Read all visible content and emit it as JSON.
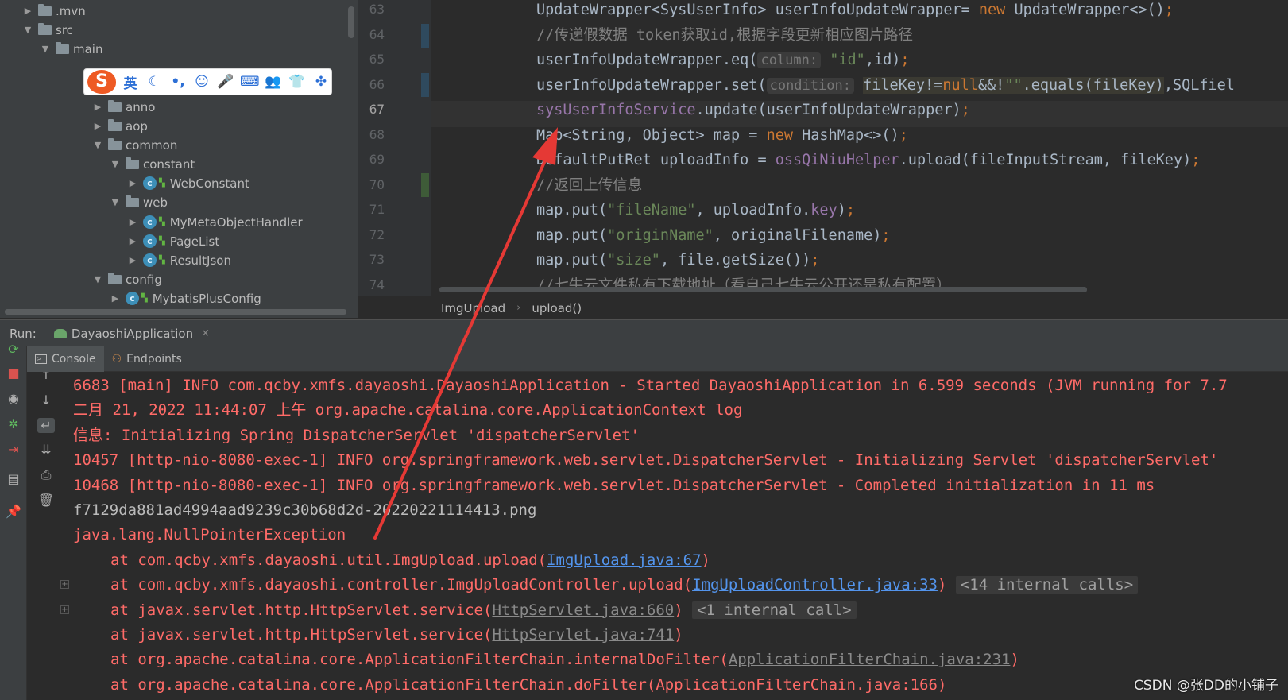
{
  "project_tree": [
    {
      "label": ".mvn",
      "kind": "folder",
      "indent": 0,
      "arrow": "right"
    },
    {
      "label": "src",
      "kind": "folder",
      "indent": 0,
      "arrow": "down"
    },
    {
      "label": "main",
      "kind": "folder",
      "indent": 1,
      "arrow": "down"
    },
    {
      "label": "anno",
      "kind": "folder",
      "indent": 4,
      "arrow": "right"
    },
    {
      "label": "aop",
      "kind": "folder",
      "indent": 4,
      "arrow": "right"
    },
    {
      "label": "common",
      "kind": "folder",
      "indent": 4,
      "arrow": "down"
    },
    {
      "label": "constant",
      "kind": "folder",
      "indent": 5,
      "arrow": "down"
    },
    {
      "label": "WebConstant",
      "kind": "class",
      "indent": 6,
      "arrow": "right"
    },
    {
      "label": "web",
      "kind": "folder",
      "indent": 5,
      "arrow": "down"
    },
    {
      "label": "MyMetaObjectHandler",
      "kind": "class",
      "indent": 6,
      "arrow": "right"
    },
    {
      "label": "PageList",
      "kind": "class",
      "indent": 6,
      "arrow": "right"
    },
    {
      "label": "ResultJson",
      "kind": "class",
      "indent": 6,
      "arrow": "right"
    },
    {
      "label": "config",
      "kind": "folder",
      "indent": 4,
      "arrow": "down"
    },
    {
      "label": "MybatisPlusConfig",
      "kind": "class",
      "indent": 5,
      "arrow": "right"
    }
  ],
  "ime": {
    "logo": "S",
    "mode": "英",
    "buttons": [
      "☾",
      "•,",
      "☺",
      "🎤",
      "⌨",
      "👥",
      "👕",
      "✣"
    ]
  },
  "editor": {
    "line_numbers": [
      "63",
      "64",
      "65",
      "66",
      "67",
      "68",
      "69",
      "70",
      "71",
      "72",
      "73",
      "74"
    ],
    "current_line": "67",
    "lines": [
      [
        {
          "t": "UpdateWrapper<SysUserInfo> userInfoUpdateWrapper= ",
          "c": ""
        },
        {
          "t": "new",
          "c": "kw"
        },
        {
          "t": " UpdateWrapper<>()",
          "c": ""
        },
        {
          "t": ";",
          "c": "kw"
        }
      ],
      [
        {
          "t": "//传递假数据 token获取id,根据字段更新相应图片路径",
          "c": "comment"
        }
      ],
      [
        {
          "t": "userInfoUpdateWrapper.eq(",
          "c": ""
        },
        {
          "t": "column:",
          "c": "hint"
        },
        {
          "t": " ",
          "c": ""
        },
        {
          "t": "\"id\"",
          "c": "str"
        },
        {
          "t": ",id)",
          "c": ""
        },
        {
          "t": ";",
          "c": "kw"
        }
      ],
      [
        {
          "t": "userInfoUpdateWrapper.set(",
          "c": ""
        },
        {
          "t": "condition:",
          "c": "hint"
        },
        {
          "t": " ",
          "c": ""
        },
        {
          "t": "fileKey!=",
          "c": "hl"
        },
        {
          "t": "null",
          "c": "kw hl"
        },
        {
          "t": "&&!",
          "c": "hl"
        },
        {
          "t": "\"\"",
          "c": "str hl"
        },
        {
          "t": ".equals(fileKey)",
          "c": "hl"
        },
        {
          "t": ",SQLfiel",
          "c": ""
        }
      ],
      [
        {
          "t": "sysUserInfoService",
          "c": "field"
        },
        {
          "t": ".update(userInfoUpdateWrapper)",
          "c": ""
        },
        {
          "t": ";",
          "c": "kw"
        }
      ],
      [
        {
          "t": "Map<String, Object> map = ",
          "c": ""
        },
        {
          "t": "new",
          "c": "kw"
        },
        {
          "t": " HashMap<>()",
          "c": ""
        },
        {
          "t": ";",
          "c": "kw"
        }
      ],
      [
        {
          "t": "DefaultPutRet uploadInfo = ",
          "c": ""
        },
        {
          "t": "ossQiNiuHelper",
          "c": "field"
        },
        {
          "t": ".upload(fileInputStream, fileKey)",
          "c": ""
        },
        {
          "t": ";",
          "c": "kw"
        }
      ],
      [
        {
          "t": "//返回上传信息",
          "c": "comment"
        }
      ],
      [
        {
          "t": "map.put(",
          "c": ""
        },
        {
          "t": "\"fileName\"",
          "c": "str"
        },
        {
          "t": ", uploadInfo.",
          "c": ""
        },
        {
          "t": "key",
          "c": "field"
        },
        {
          "t": ")",
          "c": ""
        },
        {
          "t": ";",
          "c": "kw"
        }
      ],
      [
        {
          "t": "map.put(",
          "c": ""
        },
        {
          "t": "\"originName\"",
          "c": "str"
        },
        {
          "t": ", originalFilename)",
          "c": ""
        },
        {
          "t": ";",
          "c": "kw"
        }
      ],
      [
        {
          "t": "map.put(",
          "c": ""
        },
        {
          "t": "\"size\"",
          "c": "str"
        },
        {
          "t": ", file.getSize())",
          "c": ""
        },
        {
          "t": ";",
          "c": "kw"
        }
      ],
      [
        {
          "t": "//七牛云文件私有下载地址（看自己七牛云公开还是私有配置）",
          "c": "comment"
        }
      ]
    ]
  },
  "breadcrumb": {
    "class_name": "ImgUpload",
    "method": "upload()",
    "separator": "›"
  },
  "run": {
    "label": "Run:",
    "app_name": "DayaoshiApplication",
    "close": "×",
    "tabs": [
      {
        "label": "Console",
        "active": true
      },
      {
        "label": "Endpoints",
        "active": false
      }
    ]
  },
  "console": [
    {
      "cls": "",
      "parts": [
        {
          "t": "6683 [main] INFO com.qcby.xmfs.dayaoshi.DayaoshiApplication - Started DayaoshiApplication in 6.599 seconds (JVM running for 7.7"
        }
      ]
    },
    {
      "cls": "",
      "parts": [
        {
          "t": "二月 21, 2022 11:44:07 上午 org.apache.catalina.core.ApplicationContext log"
        }
      ]
    },
    {
      "cls": "",
      "parts": [
        {
          "t": "信息: Initializing Spring DispatcherServlet 'dispatcherServlet'"
        }
      ]
    },
    {
      "cls": "",
      "parts": [
        {
          "t": "10457 [http-nio-8080-exec-1] INFO org.springframework.web.servlet.DispatcherServlet - Initializing Servlet 'dispatcherServlet'"
        }
      ]
    },
    {
      "cls": "",
      "parts": [
        {
          "t": "10468 [http-nio-8080-exec-1] INFO org.springframework.web.servlet.DispatcherServlet - Completed initialization in 11 ms"
        }
      ]
    },
    {
      "cls": "plain",
      "parts": [
        {
          "t": "f7129da881ad4994aad9239c30b68d2d-20220221114413.png"
        }
      ]
    },
    {
      "cls": "",
      "parts": [
        {
          "t": "java.lang.NullPointerException"
        }
      ]
    },
    {
      "cls": "indent",
      "parts": [
        {
          "t": "at com.qcby.xmfs.dayaoshi.util.ImgUpload.upload("
        },
        {
          "t": "ImgUpload.java:67",
          "k": "link"
        },
        {
          "t": ")"
        }
      ]
    },
    {
      "cls": "indent",
      "fold": true,
      "parts": [
        {
          "t": "at com.qcby.xmfs.dayaoshi.controller.ImgUploadController.upload("
        },
        {
          "t": "ImgUploadController.java:33",
          "k": "link"
        },
        {
          "t": ") "
        },
        {
          "t": "<14 internal calls>",
          "k": "fold"
        }
      ]
    },
    {
      "cls": "indent",
      "fold": true,
      "parts": [
        {
          "t": "at javax.servlet.http.HttpServlet.service("
        },
        {
          "t": "HttpServlet.java:660",
          "k": "visited"
        },
        {
          "t": ") "
        },
        {
          "t": "<1 internal call>",
          "k": "fold"
        }
      ]
    },
    {
      "cls": "indent",
      "parts": [
        {
          "t": "at javax.servlet.http.HttpServlet.service("
        },
        {
          "t": "HttpServlet.java:741",
          "k": "visited"
        },
        {
          "t": ")"
        }
      ]
    },
    {
      "cls": "indent",
      "parts": [
        {
          "t": "at org.apache.catalina.core.ApplicationFilterChain.internalDoFilter("
        },
        {
          "t": "ApplicationFilterChain.java:231",
          "k": "visited"
        },
        {
          "t": ")"
        }
      ]
    },
    {
      "cls": "indent",
      "parts": [
        {
          "t": "at org.apache.catalina.core.ApplicationFilterChain.doFilter(ApplicationFilterChain.java:166)"
        }
      ]
    }
  ],
  "watermark": "CSDN @张DD的小铺子",
  "colors": {
    "error_text": "#ff6b68",
    "arrow": "#e53935",
    "keyword": "#cc7832",
    "string": "#6a8759"
  }
}
